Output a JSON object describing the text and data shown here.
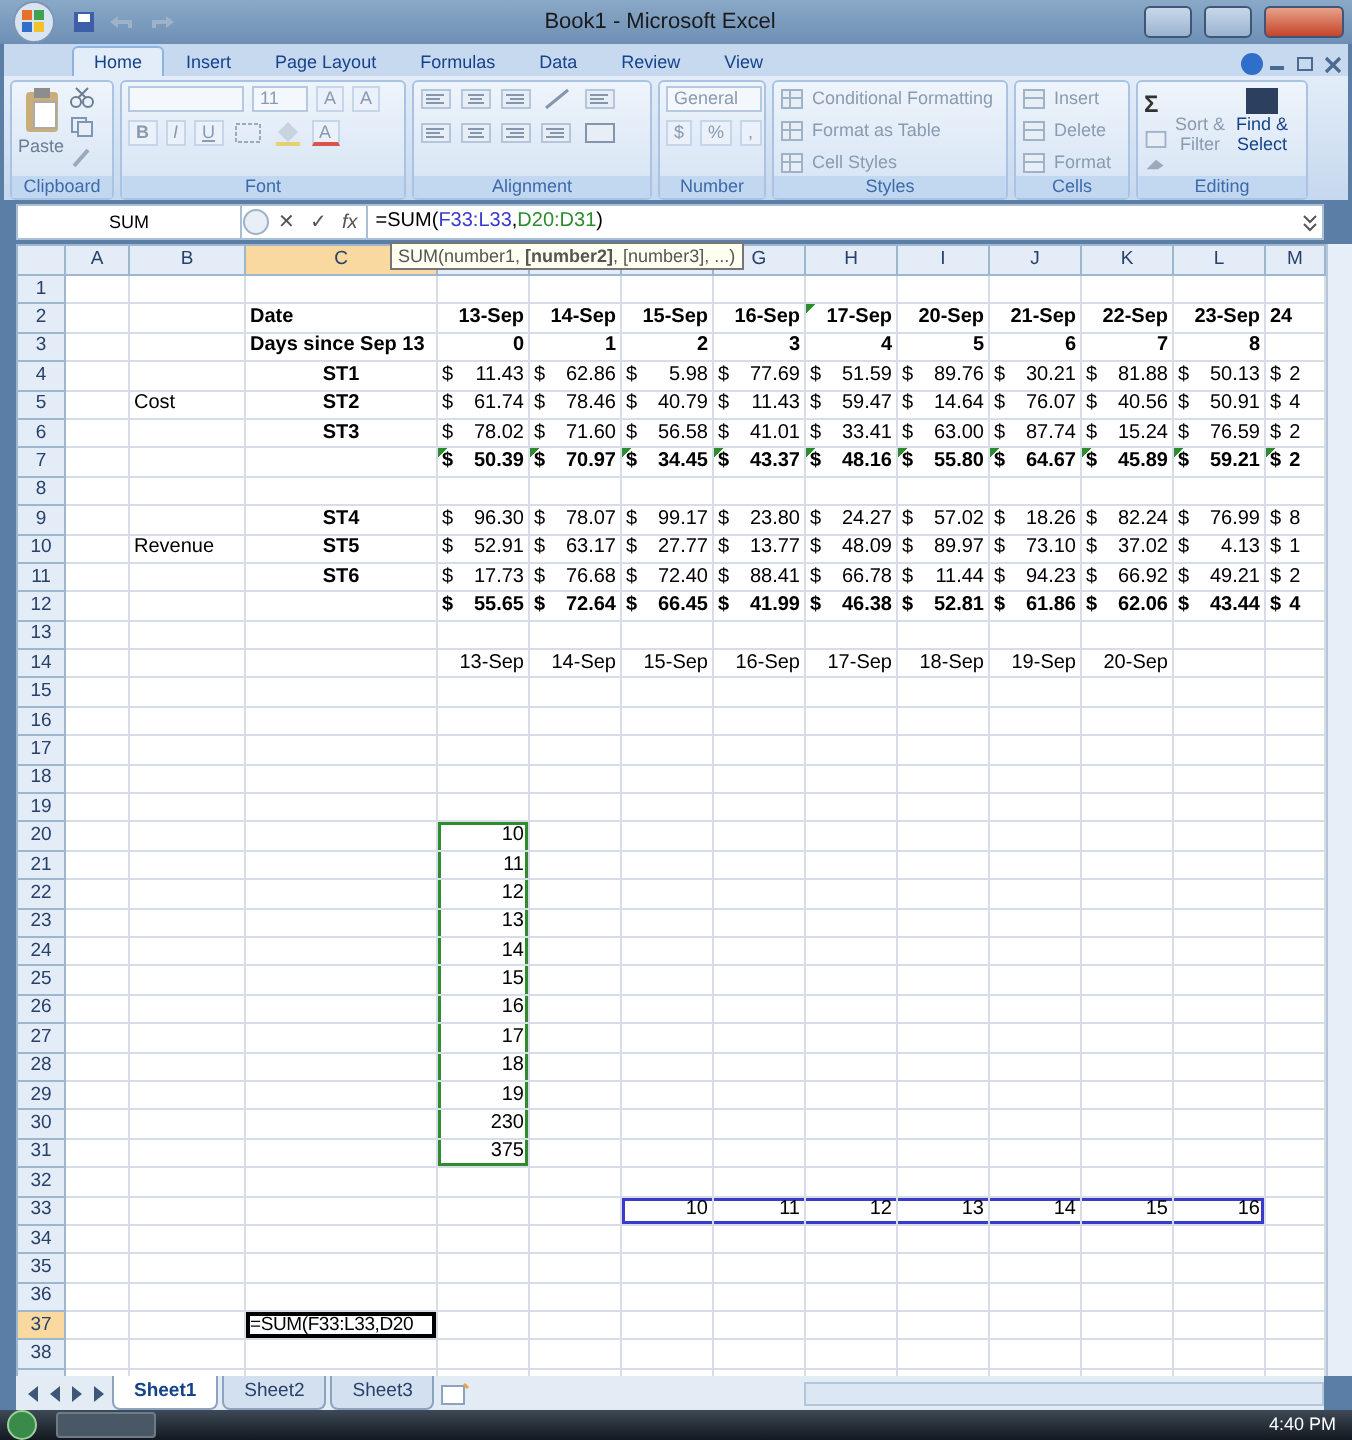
{
  "window": {
    "title": "Book1 - Microsoft Excel"
  },
  "ribbon": {
    "tabs": [
      {
        "label": "Home",
        "selected": true
      },
      {
        "label": "Insert",
        "selected": false
      },
      {
        "label": "Page Layout",
        "selected": false
      },
      {
        "label": "Formulas",
        "selected": false
      },
      {
        "label": "Data",
        "selected": false
      },
      {
        "label": "Review",
        "selected": false
      },
      {
        "label": "View",
        "selected": false
      }
    ],
    "clipboard": {
      "label": "Clipboard",
      "paste": "Paste"
    },
    "font": {
      "label": "Font",
      "size": "11",
      "grow": [
        "A",
        "A"
      ],
      "styles": [
        "B",
        "I",
        "U"
      ],
      "font_color": "A"
    },
    "alignment": {
      "label": "Alignment"
    },
    "number": {
      "label": "Number",
      "format": "General",
      "buttons": [
        "$",
        "%",
        ","
      ]
    },
    "styles": {
      "label": "Styles",
      "items": [
        "Conditional Formatting",
        "Format as Table",
        "Cell Styles"
      ]
    },
    "cells": {
      "label": "Cells",
      "items": [
        "Insert",
        "Delete",
        "Format"
      ]
    },
    "editing": {
      "label": "Editing",
      "sum": "Σ",
      "sort": "Sort & Filter",
      "find": "Find & Select"
    }
  },
  "formula_bar": {
    "name_box": "SUM",
    "buttons": [
      "✕",
      "✓",
      "fx"
    ],
    "segments": [
      {
        "text": "=SUM("
      },
      {
        "text": "F33:L33",
        "color": "#3a3acc"
      },
      {
        "text": ","
      },
      {
        "text": "D20:D31",
        "color": "#2e8b2e"
      },
      {
        "text": ")"
      }
    ],
    "tooltip": "SUM(number1, **[number2]**, [number3], ...)"
  },
  "sheet": {
    "columns": [
      {
        "label": "A",
        "selected": false
      },
      {
        "label": "B",
        "selected": false
      },
      {
        "label": "C",
        "selected": true
      },
      {
        "selected": false
      },
      {
        "selected": false
      },
      {
        "selected": false
      },
      {
        "label": "G",
        "selected": false
      },
      {
        "label": "H",
        "selected": false
      },
      {
        "label": "I",
        "selected": false
      },
      {
        "label": "J",
        "selected": false
      },
      {
        "label": "K",
        "selected": false
      },
      {
        "label": "L",
        "selected": false
      },
      {
        "label": "M",
        "selected": false
      }
    ],
    "rows": [
      {
        "label": "1",
        "selected": false
      },
      {
        "label": "2",
        "selected": false,
        "cells": [
          {},
          {},
          {
            "kind": "text",
            "text": "Date",
            "bold": true
          },
          {
            "kind": "num",
            "text": "13-Sep",
            "bold": true
          },
          {
            "kind": "num",
            "text": "14-Sep",
            "bold": true
          },
          {
            "kind": "num",
            "text": "15-Sep",
            "bold": true
          },
          {
            "kind": "num",
            "text": "16-Sep",
            "bold": true
          },
          {
            "kind": "num",
            "text": "17-Sep",
            "bold": true,
            "flag": true
          },
          {
            "kind": "num",
            "text": "20-Sep",
            "bold": true
          },
          {
            "kind": "num",
            "text": "21-Sep",
            "bold": true
          },
          {
            "kind": "num",
            "text": "22-Sep",
            "bold": true
          },
          {
            "kind": "num",
            "text": "23-Sep",
            "bold": true
          },
          {
            "kind": "text",
            "text": "24",
            "bold": true
          }
        ]
      },
      {
        "label": "3",
        "selected": false,
        "cells": [
          {},
          {},
          {
            "kind": "text",
            "text": "Days since Sep 13",
            "bold": true
          },
          {
            "kind": "num",
            "text": "0",
            "bold": true
          },
          {
            "kind": "num",
            "text": "1",
            "bold": true
          },
          {
            "kind": "num",
            "text": "2",
            "bold": true
          },
          {
            "kind": "num",
            "text": "3",
            "bold": true
          },
          {
            "kind": "num",
            "text": "4",
            "bold": true
          },
          {
            "kind": "num",
            "text": "5",
            "bold": true
          },
          {
            "kind": "num",
            "text": "6",
            "bold": true
          },
          {
            "kind": "num",
            "text": "7",
            "bold": true
          },
          {
            "kind": "num",
            "text": "8",
            "bold": true
          }
        ]
      },
      {
        "label": "4",
        "selected": false,
        "cells": [
          {},
          {},
          {
            "kind": "center",
            "text": "ST1",
            "bold": true
          },
          {
            "kind": "money",
            "cur": "$",
            "text": "11.43"
          },
          {
            "kind": "money",
            "cur": "$",
            "text": "62.86"
          },
          {
            "kind": "money",
            "cur": "$",
            "text": "5.98"
          },
          {
            "kind": "money",
            "cur": "$",
            "text": "77.69"
          },
          {
            "kind": "money",
            "cur": "$",
            "text": "51.59"
          },
          {
            "kind": "money",
            "cur": "$",
            "text": "89.76"
          },
          {
            "kind": "money",
            "cur": "$",
            "text": "30.21"
          },
          {
            "kind": "money",
            "cur": "$",
            "text": "81.88"
          },
          {
            "kind": "money",
            "cur": "$",
            "text": "50.13"
          },
          {
            "kind": "cut",
            "cur": "$",
            "text": "2"
          }
        ]
      },
      {
        "label": "5",
        "selected": false,
        "cells": [
          {},
          {
            "kind": "text",
            "text": "Cost"
          },
          {
            "kind": "center",
            "text": "ST2",
            "bold": true
          },
          {
            "kind": "money",
            "cur": "$",
            "text": "61.74"
          },
          {
            "kind": "money",
            "cur": "$",
            "text": "78.46"
          },
          {
            "kind": "money",
            "cur": "$",
            "text": "40.79"
          },
          {
            "kind": "money",
            "cur": "$",
            "text": "11.43"
          },
          {
            "kind": "money",
            "cur": "$",
            "text": "59.47"
          },
          {
            "kind": "money",
            "cur": "$",
            "text": "14.64"
          },
          {
            "kind": "money",
            "cur": "$",
            "text": "76.07"
          },
          {
            "kind": "money",
            "cur": "$",
            "text": "40.56"
          },
          {
            "kind": "money",
            "cur": "$",
            "text": "50.91"
          },
          {
            "kind": "cut",
            "cur": "$",
            "text": "4"
          }
        ]
      },
      {
        "label": "6",
        "selected": false,
        "cells": [
          {},
          {},
          {
            "kind": "center",
            "text": "ST3",
            "bold": true
          },
          {
            "kind": "money",
            "cur": "$",
            "text": "78.02"
          },
          {
            "kind": "money",
            "cur": "$",
            "text": "71.60"
          },
          {
            "kind": "money",
            "cur": "$",
            "text": "56.58"
          },
          {
            "kind": "money",
            "cur": "$",
            "text": "41.01"
          },
          {
            "kind": "money",
            "cur": "$",
            "text": "33.41"
          },
          {
            "kind": "money",
            "cur": "$",
            "text": "63.00"
          },
          {
            "kind": "money",
            "cur": "$",
            "text": "87.74"
          },
          {
            "kind": "money",
            "cur": "$",
            "text": "15.24"
          },
          {
            "kind": "money",
            "cur": "$",
            "text": "76.59"
          },
          {
            "kind": "cut",
            "cur": "$",
            "text": "2"
          }
        ]
      },
      {
        "label": "7",
        "selected": false,
        "cells": [
          {},
          {},
          {},
          {
            "kind": "money",
            "cur": "$",
            "text": "50.39",
            "bold": true,
            "flag": true
          },
          {
            "kind": "money",
            "cur": "$",
            "text": "70.97",
            "bold": true,
            "flag": true
          },
          {
            "kind": "money",
            "cur": "$",
            "text": "34.45",
            "bold": true,
            "flag": true
          },
          {
            "kind": "money",
            "cur": "$",
            "text": "43.37",
            "bold": true,
            "flag": true
          },
          {
            "kind": "money",
            "cur": "$",
            "text": "48.16",
            "bold": true,
            "flag": true
          },
          {
            "kind": "money",
            "cur": "$",
            "text": "55.80",
            "bold": true,
            "flag": true
          },
          {
            "kind": "money",
            "cur": "$",
            "text": "64.67",
            "bold": true,
            "flag": true
          },
          {
            "kind": "money",
            "cur": "$",
            "text": "45.89",
            "bold": true,
            "flag": true
          },
          {
            "kind": "money",
            "cur": "$",
            "text": "59.21",
            "bold": true,
            "flag": true
          },
          {
            "kind": "cut",
            "cur": "$",
            "text": "2",
            "bold": true,
            "flag": true
          }
        ]
      },
      {
        "label": "8",
        "selected": false
      },
      {
        "label": "9",
        "selected": false,
        "cells": [
          {},
          {},
          {
            "kind": "center",
            "text": "ST4",
            "bold": true
          },
          {
            "kind": "money",
            "cur": "$",
            "text": "96.30"
          },
          {
            "kind": "money",
            "cur": "$",
            "text": "78.07"
          },
          {
            "kind": "money",
            "cur": "$",
            "text": "99.17"
          },
          {
            "kind": "money",
            "cur": "$",
            "text": "23.80"
          },
          {
            "kind": "money",
            "cur": "$",
            "text": "24.27"
          },
          {
            "kind": "money",
            "cur": "$",
            "text": "57.02"
          },
          {
            "kind": "money",
            "cur": "$",
            "text": "18.26"
          },
          {
            "kind": "money",
            "cur": "$",
            "text": "82.24"
          },
          {
            "kind": "money",
            "cur": "$",
            "text": "76.99"
          },
          {
            "kind": "cut",
            "cur": "$",
            "text": "8"
          }
        ]
      },
      {
        "label": "10",
        "selected": false,
        "cells": [
          {},
          {
            "kind": "text",
            "text": "Revenue"
          },
          {
            "kind": "center",
            "text": "ST5",
            "bold": true
          },
          {
            "kind": "money",
            "cur": "$",
            "text": "52.91"
          },
          {
            "kind": "money",
            "cur": "$",
            "text": "63.17"
          },
          {
            "kind": "money",
            "cur": "$",
            "text": "27.77"
          },
          {
            "kind": "money",
            "cur": "$",
            "text": "13.77"
          },
          {
            "kind": "money",
            "cur": "$",
            "text": "48.09"
          },
          {
            "kind": "money",
            "cur": "$",
            "text": "89.97"
          },
          {
            "kind": "money",
            "cur": "$",
            "text": "73.10"
          },
          {
            "kind": "money",
            "cur": "$",
            "text": "37.02"
          },
          {
            "kind": "money",
            "cur": "$",
            "text": "4.13"
          },
          {
            "kind": "cut",
            "cur": "$",
            "text": "1"
          }
        ]
      },
      {
        "label": "11",
        "selected": false,
        "cells": [
          {},
          {},
          {
            "kind": "center",
            "text": "ST6",
            "bold": true
          },
          {
            "kind": "money",
            "cur": "$",
            "text": "17.73"
          },
          {
            "kind": "money",
            "cur": "$",
            "text": "76.68"
          },
          {
            "kind": "money",
            "cur": "$",
            "text": "72.40"
          },
          {
            "kind": "money",
            "cur": "$",
            "text": "88.41"
          },
          {
            "kind": "money",
            "cur": "$",
            "text": "66.78"
          },
          {
            "kind": "money",
            "cur": "$",
            "text": "11.44"
          },
          {
            "kind": "money",
            "cur": "$",
            "text": "94.23"
          },
          {
            "kind": "money",
            "cur": "$",
            "text": "66.92"
          },
          {
            "kind": "money",
            "cur": "$",
            "text": "49.21"
          },
          {
            "kind": "cut",
            "cur": "$",
            "text": "2"
          }
        ]
      },
      {
        "label": "12",
        "selected": false,
        "cells": [
          {},
          {},
          {},
          {
            "kind": "money",
            "cur": "$",
            "text": "55.65",
            "bold": true
          },
          {
            "kind": "money",
            "cur": "$",
            "text": "72.64",
            "bold": true
          },
          {
            "kind": "money",
            "cur": "$",
            "text": "66.45",
            "bold": true
          },
          {
            "kind": "money",
            "cur": "$",
            "text": "41.99",
            "bold": true
          },
          {
            "kind": "money",
            "cur": "$",
            "text": "46.38",
            "bold": true
          },
          {
            "kind": "money",
            "cur": "$",
            "text": "52.81",
            "bold": true
          },
          {
            "kind": "money",
            "cur": "$",
            "text": "61.86",
            "bold": true
          },
          {
            "kind": "money",
            "cur": "$",
            "text": "62.06",
            "bold": true
          },
          {
            "kind": "money",
            "cur": "$",
            "text": "43.44",
            "bold": true
          },
          {
            "kind": "cut",
            "cur": "$",
            "text": "4",
            "bold": true
          }
        ]
      },
      {
        "label": "13",
        "selected": false
      },
      {
        "label": "14",
        "selected": false,
        "cells": [
          {},
          {},
          {},
          {
            "kind": "num",
            "text": "13-Sep"
          },
          {
            "kind": "num",
            "text": "14-Sep"
          },
          {
            "kind": "num",
            "text": "15-Sep"
          },
          {
            "kind": "num",
            "text": "16-Sep"
          },
          {
            "kind": "num",
            "text": "17-Sep"
          },
          {
            "kind": "num",
            "text": "18-Sep"
          },
          {
            "kind": "num",
            "text": "19-Sep"
          },
          {
            "kind": "num",
            "text": "20-Sep"
          }
        ]
      },
      {
        "label": "15",
        "selected": false
      },
      {
        "label": "16",
        "selected": false
      },
      {
        "label": "17",
        "selected": false
      },
      {
        "label": "18",
        "selected": false
      },
      {
        "label": "19",
        "selected": false
      },
      {
        "label": "20",
        "selected": false,
        "cells": [
          {},
          {},
          {},
          {
            "kind": "num",
            "text": "10",
            "color": "#2e8b2e"
          }
        ]
      },
      {
        "label": "21",
        "selected": false,
        "cells": [
          {},
          {},
          {},
          {
            "kind": "num",
            "text": "11",
            "color": "#2e8b2e"
          }
        ]
      },
      {
        "label": "22",
        "selected": false,
        "cells": [
          {},
          {},
          {},
          {
            "kind": "num",
            "text": "12",
            "color": "#2e8b2e"
          }
        ]
      },
      {
        "label": "23",
        "selected": false,
        "cells": [
          {},
          {},
          {},
          {
            "kind": "num",
            "text": "13",
            "color": "#2e8b2e"
          }
        ]
      },
      {
        "label": "24",
        "selected": false,
        "cells": [
          {},
          {},
          {},
          {
            "kind": "num",
            "text": "14",
            "color": "#2e8b2e"
          }
        ]
      },
      {
        "label": "25",
        "selected": false,
        "cells": [
          {},
          {},
          {},
          {
            "kind": "num",
            "text": "15",
            "color": "#2e8b2e"
          }
        ]
      },
      {
        "label": "26",
        "selected": false,
        "cells": [
          {},
          {},
          {},
          {
            "kind": "num",
            "text": "16",
            "color": "#2e8b2e"
          }
        ]
      },
      {
        "label": "27",
        "selected": false,
        "cells": [
          {},
          {},
          {},
          {
            "kind": "num",
            "text": "17",
            "color": "#2e8b2e"
          }
        ]
      },
      {
        "label": "28",
        "selected": false,
        "cells": [
          {},
          {},
          {},
          {
            "kind": "num",
            "text": "18",
            "color": "#2e8b2e"
          }
        ]
      },
      {
        "label": "29",
        "selected": false,
        "cells": [
          {},
          {},
          {},
          {
            "kind": "num",
            "text": "19",
            "color": "#2e8b2e"
          }
        ]
      },
      {
        "label": "30",
        "selected": false,
        "cells": [
          {},
          {},
          {},
          {
            "kind": "num",
            "text": "230",
            "color": "#2e8b2e"
          }
        ]
      },
      {
        "label": "31",
        "selected": false,
        "cells": [
          {},
          {},
          {},
          {
            "kind": "num",
            "text": "375",
            "color": "#2e8b2e"
          }
        ]
      },
      {
        "label": "32",
        "selected": false
      },
      {
        "label": "33",
        "selected": false,
        "cells": [
          {},
          {},
          {},
          {},
          {},
          {
            "kind": "num",
            "text": "10",
            "color": "#3a3acc"
          },
          {
            "kind": "num",
            "text": "11",
            "color": "#3a3acc"
          },
          {
            "kind": "num",
            "text": "12",
            "color": "#3a3acc"
          },
          {
            "kind": "num",
            "text": "13",
            "color": "#3a3acc"
          },
          {
            "kind": "num",
            "text": "14",
            "color": "#3a3acc"
          },
          {
            "kind": "num",
            "text": "15",
            "color": "#3a3acc"
          },
          {
            "kind": "num",
            "text": "16",
            "color": "#3a3acc"
          }
        ]
      },
      {
        "label": "34",
        "selected": false
      },
      {
        "label": "35",
        "selected": false
      },
      {
        "label": "36",
        "selected": false
      },
      {
        "label": "37",
        "selected": true,
        "cells": [
          {},
          {},
          {
            "kind": "text",
            "text": "=SUM(F33:L33,D20",
            "active": true
          }
        ]
      },
      {
        "label": "38",
        "selected": false
      }
    ]
  },
  "sheet_tabs": [
    {
      "label": "Sheet1",
      "selected": true
    },
    {
      "label": "Sheet2",
      "selected": false
    },
    {
      "label": "Sheet3",
      "selected": false
    }
  ],
  "taskbar": {
    "clock": "4:40 PM"
  }
}
